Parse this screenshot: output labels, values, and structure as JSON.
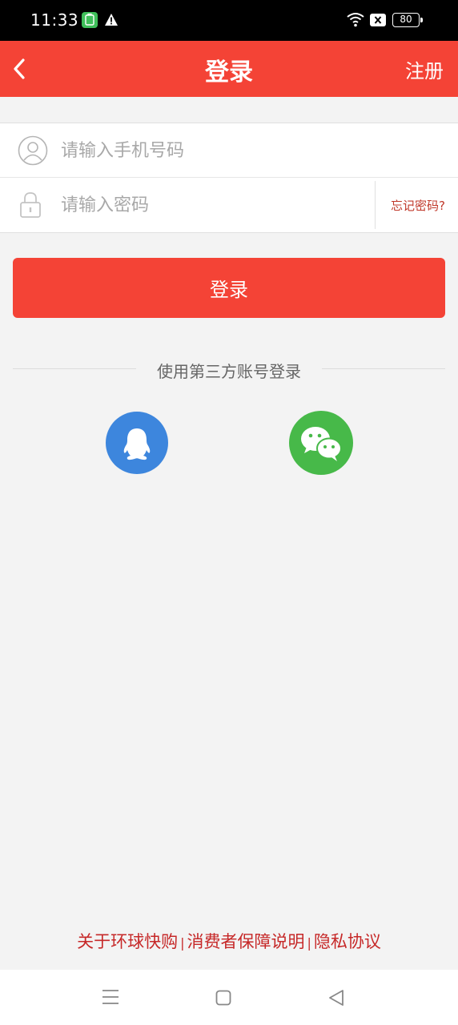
{
  "status_bar": {
    "time": "11:33",
    "battery": "80",
    "icons": [
      "app-icon",
      "warning-icon",
      "wifi-icon",
      "close-box-icon",
      "battery-icon"
    ]
  },
  "header": {
    "title": "登录",
    "register_label": "注册",
    "back_icon": "chevron-left-icon",
    "background_color": "#f44336"
  },
  "form": {
    "phone_placeholder": "请输入手机号码",
    "phone_value": "",
    "password_placeholder": "请输入密码",
    "password_value": "",
    "forgot_label": "忘记密码?",
    "phone_icon": "user-icon",
    "password_icon": "lock-icon"
  },
  "login_button": {
    "label": "登录",
    "color": "#f44336"
  },
  "third_party": {
    "label": "使用第三方账号登录",
    "providers": [
      {
        "name": "qq-icon",
        "color": "#3d86dd"
      },
      {
        "name": "wechat-icon",
        "color": "#47b949"
      }
    ]
  },
  "footer": {
    "about": "关于环球快购",
    "consumer": "消费者保障说明",
    "privacy": "隐私协议",
    "separator": "|"
  },
  "nav_bar": {
    "icons": [
      "menu-icon",
      "home-icon",
      "back-icon"
    ]
  }
}
